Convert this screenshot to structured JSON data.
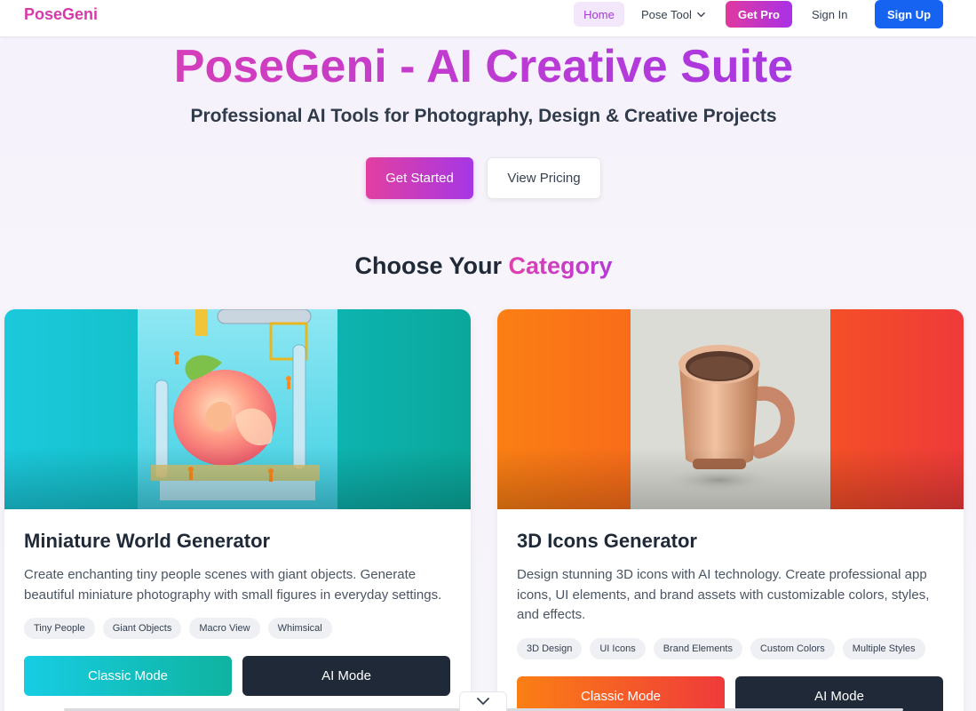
{
  "nav": {
    "logo": "PoseGeni",
    "home": "Home",
    "pose_tool": "Pose Tool",
    "get_pro": "Get Pro",
    "sign_in": "Sign In",
    "sign_up": "Sign Up"
  },
  "hero": {
    "title": "PoseGeni - AI Creative Suite",
    "subtitle": "Professional AI Tools for Photography, Design & Creative Projects",
    "get_started": "Get Started",
    "view_pricing": "View Pricing"
  },
  "section": {
    "title_prefix": "Choose Your ",
    "title_accent": "Category"
  },
  "cards": [
    {
      "title": "Miniature World Generator",
      "description": "Create enchanting tiny people scenes with giant objects. Generate beautiful miniature photography with small figures in everyday settings.",
      "tags": [
        "Tiny People",
        "Giant Objects",
        "Macro View",
        "Whimsical"
      ],
      "classic": "Classic Mode",
      "ai": "AI Mode"
    },
    {
      "title": "3D Icons Generator",
      "description": "Design stunning 3D icons with AI technology. Create professional app icons, UI elements, and brand assets with customizable colors, styles, and effects.",
      "tags": [
        "3D Design",
        "UI Icons",
        "Brand Elements",
        "Custom Colors",
        "Multiple Styles"
      ],
      "classic": "Classic Mode",
      "ai": "AI Mode"
    }
  ],
  "colors": {
    "brand_pink": "#e23fae",
    "brand_purple": "#a637e5",
    "sign_up_blue": "#1663f2",
    "dark_button": "#1f2937"
  },
  "icons": {
    "pose_tool_dropdown": "chevron-down-icon",
    "scroll_down": "chevron-down-icon"
  }
}
